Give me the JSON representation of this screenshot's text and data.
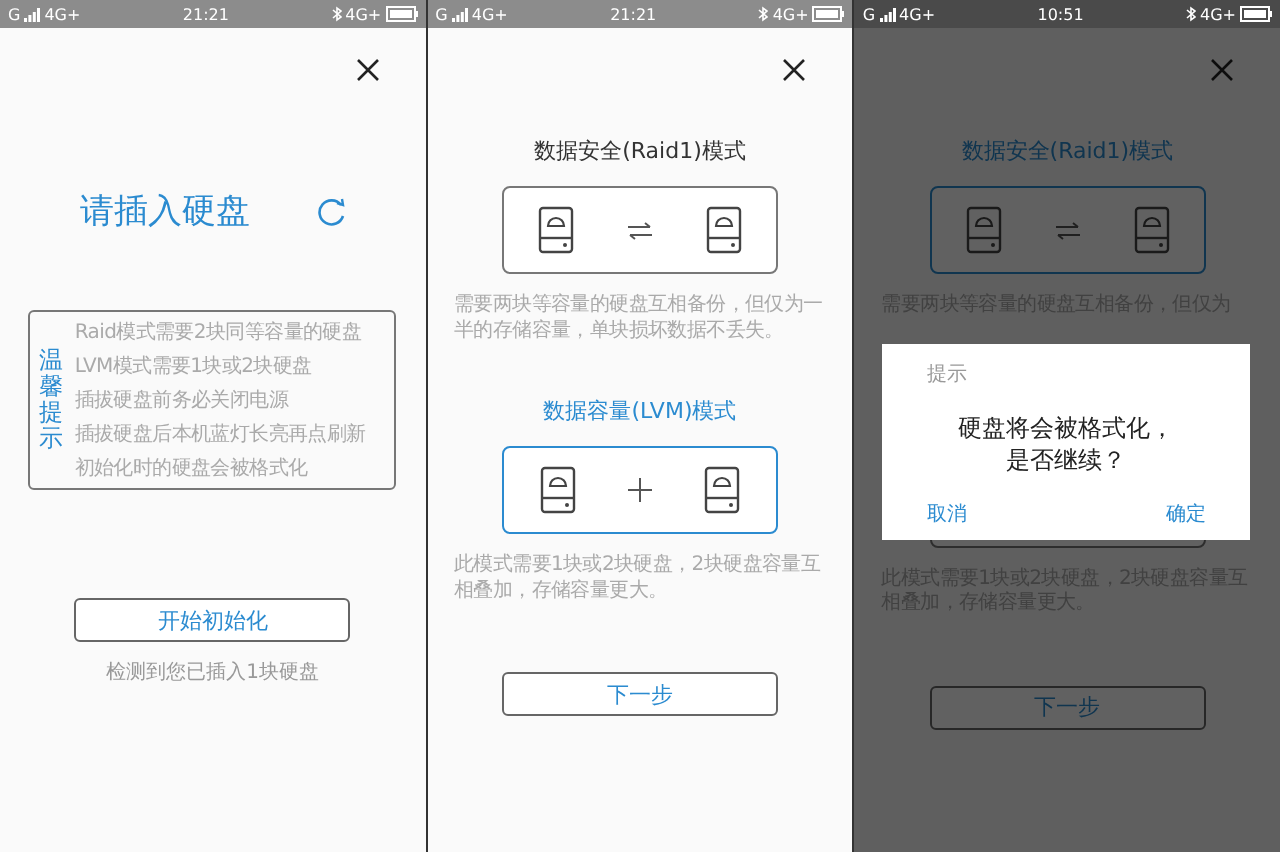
{
  "screens": [
    {
      "kind": "insert_disk",
      "status_bar": {
        "carrier": "G",
        "network": "4G+",
        "time": "21:21",
        "network_right": "4G+"
      },
      "title": "请插入硬盘",
      "tips": {
        "label": "温馨提示",
        "lines": [
          "Raid模式需要2块同等容量的硬盘",
          "LVM模式需要1块或2块硬盘",
          "插拔硬盘前务必关闭电源",
          "插拔硬盘后本机蓝灯长亮再点刷新",
          "初始化时的硬盘会被格式化"
        ]
      },
      "button": "开始初始化",
      "note": "检测到您已插入1块硬盘"
    },
    {
      "kind": "mode_select",
      "status_bar": {
        "carrier": "G",
        "network": "4G+",
        "time": "21:21",
        "network_right": "4G+"
      },
      "modes": [
        {
          "title": "数据安全(Raid1)模式",
          "kind": "swap",
          "selected": false,
          "description": "需要两块等容量的硬盘互相备份，但仅为一半的存储容量，单块损坏数据不丢失。"
        },
        {
          "title": "数据容量(LVM)模式",
          "kind": "plus",
          "selected": true,
          "description": "此模式需要1块或2块硬盘，2块硬盘容量互相叠加，存储容量更大。"
        }
      ],
      "button": "下一步"
    },
    {
      "kind": "mode_select",
      "status_bar": {
        "carrier": "G",
        "network": "4G+",
        "time": "10:51",
        "network_right": "4G+"
      },
      "modes": [
        {
          "title": "数据安全(Raid1)模式",
          "kind": "swap",
          "selected": true,
          "description": "需要两块等容量的硬盘互相备份，但仅为"
        },
        {
          "selected": false,
          "description": "此模式需要1块或2块硬盘，2块硬盘容量互相叠加，存储容量更大。"
        }
      ],
      "button": "下一步",
      "dialog": {
        "title": "提示",
        "message": "硬盘将会被格式化，是否继续？",
        "buttons": [
          "取消",
          "确定"
        ]
      }
    }
  ]
}
